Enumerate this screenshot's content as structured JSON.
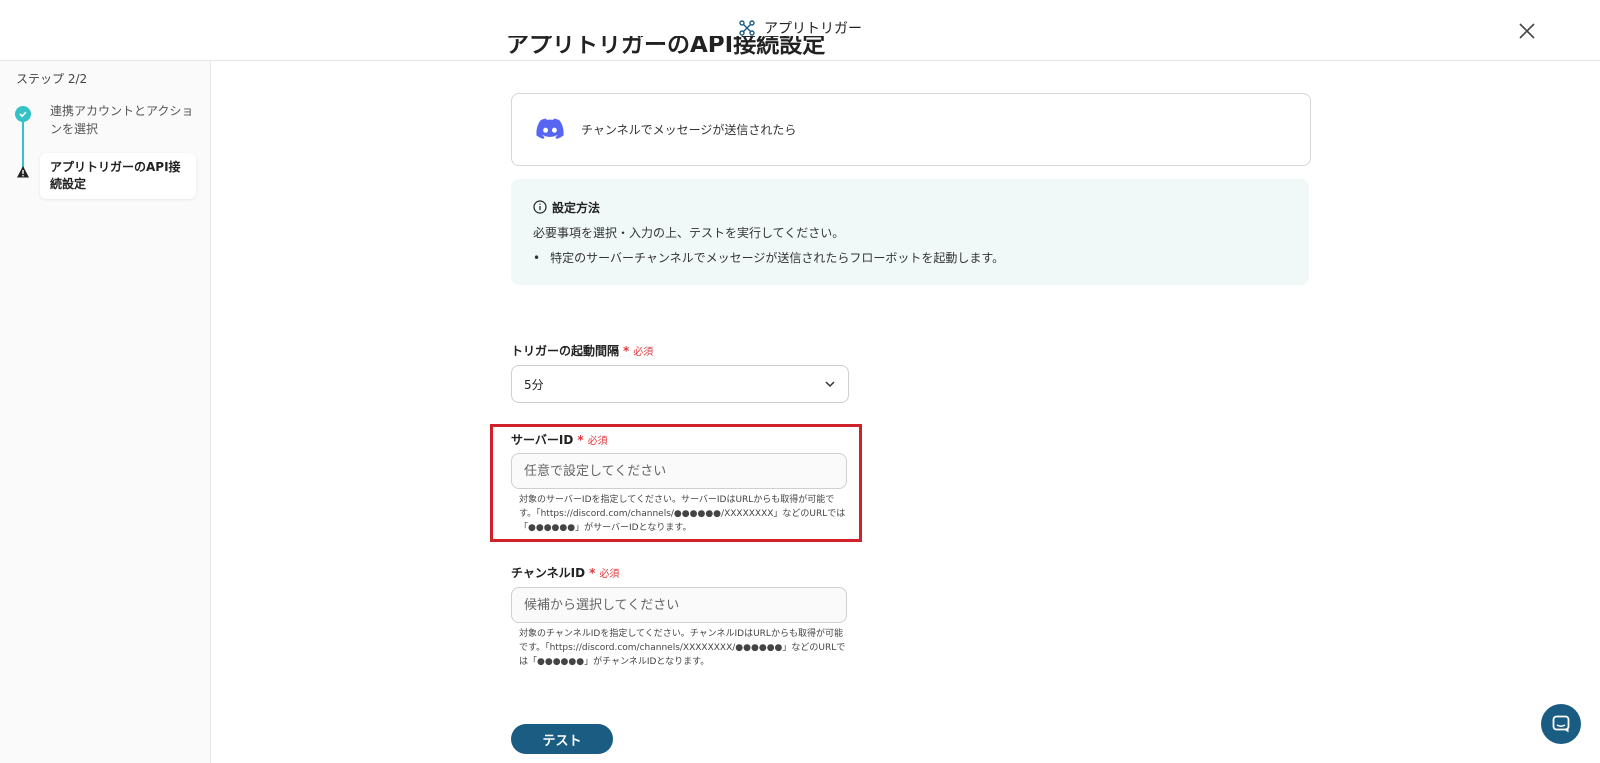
{
  "header": {
    "title": "アプリトリガー"
  },
  "sidebar": {
    "step_label": "ステップ 2/2",
    "steps": [
      {
        "label": "連携アカウントとアクションを選択",
        "status": "done"
      },
      {
        "label": "アプリトリガーのAPI接続設定",
        "status": "current"
      }
    ]
  },
  "main": {
    "title": "アプリトリガーのAPI接続設定",
    "action_card": {
      "icon": "discord-icon",
      "text": "チャンネルでメッセージが送信されたら"
    },
    "info": {
      "title": "設定方法",
      "line1": "必要事項を選択・入力の上、テストを実行してください。",
      "bullet": "特定のサーバーチャンネルでメッセージが送信されたらフローボットを起動します。"
    },
    "fields": {
      "interval": {
        "label": "トリガーの起動間隔",
        "required": "必須",
        "value": "5分"
      },
      "server_id": {
        "label": "サーバーID",
        "required": "必須",
        "placeholder": "任意で設定してください",
        "help": "対象のサーバーIDを指定してください。サーバーIDはURLからも取得が可能です。「https://discord.com/channels/●●●●●●/XXXXXXXX」などのURLでは「●●●●●●」がサーバーIDとなります。"
      },
      "channel_id": {
        "label": "チャンネルID",
        "required": "必須",
        "placeholder": "候補から選択してください",
        "help": "対象のチャンネルIDを指定してください。チャンネルIDはURLからも取得が可能です。「https://discord.com/channels/XXXXXXXX/●●●●●●」などのURLでは「●●●●●●」がチャンネルIDとなります。"
      }
    },
    "test_button": "テスト"
  },
  "colors": {
    "accent": "#1a5c82",
    "teal": "#33c2c5",
    "required": "#e0383e",
    "highlight": "#d0202a",
    "discord": "#5865f2"
  }
}
